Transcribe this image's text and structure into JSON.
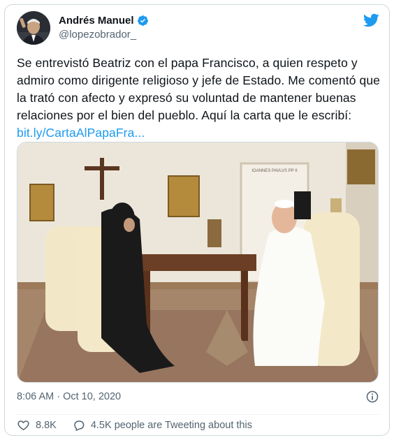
{
  "tweet": {
    "author_name": "Andrés Manuel",
    "author_handle": "@lopezobrador_",
    "text_before_link": "Se entrevistó Beatriz con el papa Francisco, a quien respeto y admiro como dirigente religioso y jefe de Estado. Me comentó que la trató con afecto y expresó su voluntad de mantener buenas relaciones por el bien del pueblo. Aquí la carta que le escribí: ",
    "link_text": "bit.ly/CartaAlPapaFra...",
    "timestamp": "8:06 AM · Oct 10, 2020",
    "likes": "8.8K",
    "replies_text": "4.5K people are Tweeting about this",
    "photo_placard": "IOANNES PAVLVS PP II"
  },
  "colors": {
    "brand_blue": "#1d9bf0",
    "text": "#0f1419",
    "secondary": "#536471"
  },
  "icons": [
    "verified-badge-icon",
    "twitter-bird-icon",
    "info-icon",
    "heart-icon",
    "reply-bubble-icon"
  ]
}
